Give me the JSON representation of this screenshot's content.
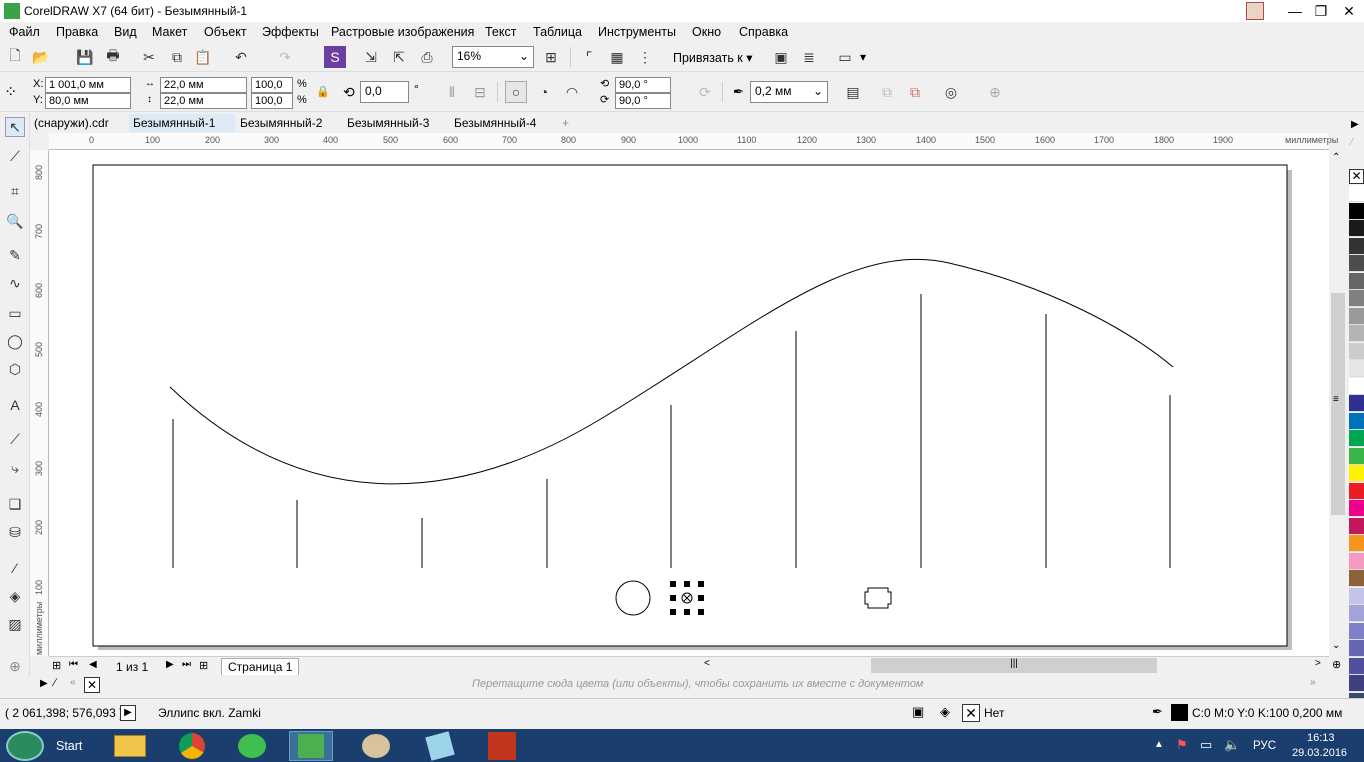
{
  "window": {
    "title": "CorelDRAW X7 (64 бит) - Безымянный-1",
    "minimize": "—",
    "maximize": "❐",
    "close": "✕"
  },
  "menu": [
    "Файл",
    "Правка",
    "Вид",
    "Макет",
    "Объект",
    "Эффекты",
    "Растровые изображения",
    "Текст",
    "Таблица",
    "Инструменты",
    "Окно",
    "Справка"
  ],
  "toolbar1": {
    "zoom": "16%",
    "snap_label": "Привязать к"
  },
  "toolbar2": {
    "x_label": "X:",
    "x_value": "1 001,0 мм",
    "y_label": "Y:",
    "y_value": "80,0 мм",
    "width_value": "22,0 мм",
    "height_value": "22,0 мм",
    "scale_x": "100,0",
    "scale_y": "100,0",
    "percent": "%",
    "rotation": "0,0",
    "degree": "°",
    "angle_start": "90,0 °",
    "angle_end": "90,0 °",
    "outline_width": "0,2 мм"
  },
  "tabs": [
    "(снаружи).cdr",
    "Безымянный-1",
    "Безымянный-2",
    "Безымянный-3",
    "Безымянный-4"
  ],
  "active_tab_index": 1,
  "ruler": {
    "h_labels": [
      "0",
      "100",
      "200",
      "300",
      "400",
      "500",
      "600",
      "700",
      "800",
      "900",
      "1000",
      "1100",
      "1200",
      "1300",
      "1400",
      "1500",
      "1600",
      "1700",
      "1800",
      "1900"
    ],
    "units": "миллиметры",
    "v_labels": [
      "800",
      "700",
      "600",
      "500",
      "400",
      "300",
      "200",
      "100"
    ]
  },
  "page_nav": {
    "counter": "1 из 1",
    "page_tab": "Страница 1"
  },
  "docker_hint": "Перетащите сюда цвета (или объекты), чтобы сохранить их вместе с документом",
  "status": {
    "coords": "( 2 061,398; 576,093 )",
    "object": "Эллипс вкл. Zamki",
    "fill": "Нет",
    "outline": "C:0 M:0 Y:0 K:100  0,200 мм"
  },
  "taskbar": {
    "start": "Start",
    "lang": "РУС",
    "time": "16:13",
    "date": "29.03.2016"
  },
  "palette_colors": [
    "#ffffff",
    "#000000",
    "#1a1a1a",
    "#333333",
    "#4d4d4d",
    "#666666",
    "#808080",
    "#999999",
    "#b3b3b3",
    "#cccccc",
    "#e6e6e6",
    "#ffffff",
    "#2e3192",
    "#0072bc",
    "#00a651",
    "#39b54a",
    "#fff200",
    "#ed1c24",
    "#ec008c",
    "#c2185b",
    "#f7941d",
    "#f49ac1",
    "#8c6239",
    "#c4c4e8",
    "#a3a3d9",
    "#8080c8",
    "#6666b3",
    "#50509e",
    "#404080",
    "#3d4a6e"
  ]
}
